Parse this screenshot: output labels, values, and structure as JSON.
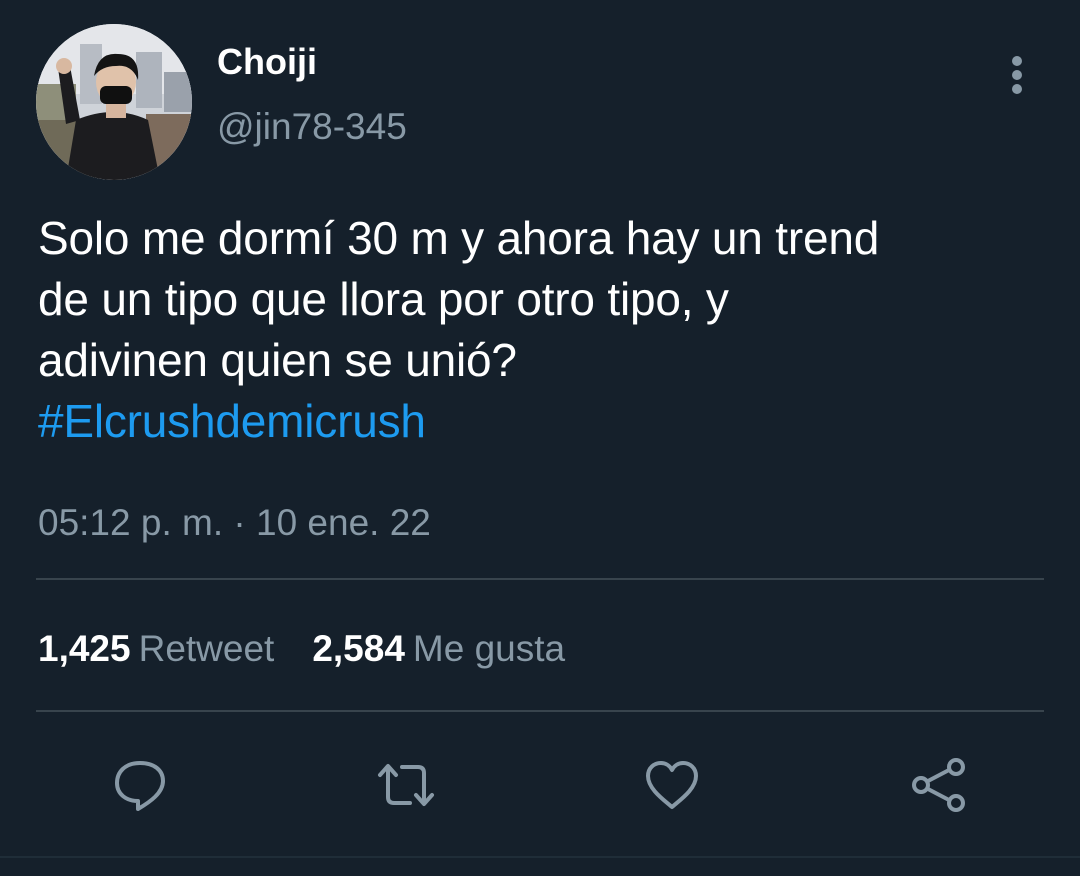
{
  "author": {
    "display_name": "Choiji",
    "handle": "@jin78-345"
  },
  "tweet": {
    "text_lines": [
      "Solo me dormí 30 m y ahora hay un trend",
      "de un tipo que llora por otro tipo, y",
      "adivinen quien se unió?"
    ],
    "hashtag": "#Elcrushdemicrush",
    "time": "05:12 p. m.",
    "separator": "·",
    "date": "10 ene. 22"
  },
  "stats": {
    "retweets_count": "1,425",
    "retweets_label": "Retweet",
    "likes_count": "2,584",
    "likes_label": "Me gusta"
  },
  "icons": {
    "more": "more-vertical-icon",
    "reply": "reply-icon",
    "retweet": "retweet-icon",
    "like": "heart-icon",
    "share": "share-icon"
  },
  "colors": {
    "background": "#15202b",
    "text": "#ffffff",
    "secondary": "#8899a6",
    "link": "#1d9bf0",
    "divider": "#38444d"
  }
}
